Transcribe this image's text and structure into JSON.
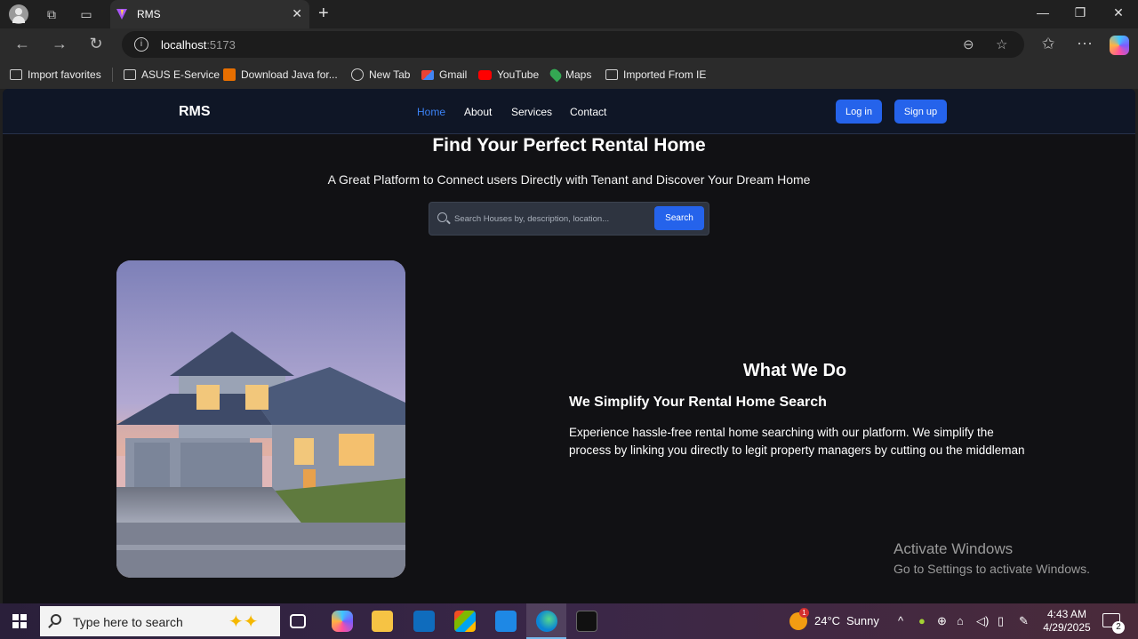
{
  "browser": {
    "tab_title": "RMS",
    "url_host": "localhost",
    "url_port": ":5173",
    "bookmarks": [
      "Import favorites",
      "ASUS E-Service",
      "Download Java for...",
      "New Tab",
      "Gmail",
      "YouTube",
      "Maps",
      "Imported From IE"
    ]
  },
  "site": {
    "brand": "RMS",
    "nav": [
      "Home",
      "About",
      "Services",
      "Contact"
    ],
    "active_nav": "Home",
    "login_label": "Log in",
    "signup_label": "Sign up",
    "accent_color": "#2563eb",
    "hero_title": "Find Your Perfect Rental Home",
    "hero_subtitle": "A Great Platform to Connect users Directly with Tenant and Discover Your Dream Home",
    "search_placeholder": "Search Houses by, description, location...",
    "search_button": "Search",
    "section_title": "What We Do",
    "section_subtitle": "We Simplify Your Rental Home Search",
    "section_body": "Experience hassle-free rental home searching with our platform. We simplify the process by linking you directly to legit property managers by cutting ou the middleman"
  },
  "watermark": {
    "line1": "Activate Windows",
    "line2": "Go to Settings to activate Windows."
  },
  "taskbar": {
    "search_placeholder": "Type here to search",
    "weather_temp": "24°C",
    "weather_text": "Sunny",
    "weather_badge": "1",
    "time": "4:43 AM",
    "date": "4/29/2025",
    "notification_count": "2"
  }
}
